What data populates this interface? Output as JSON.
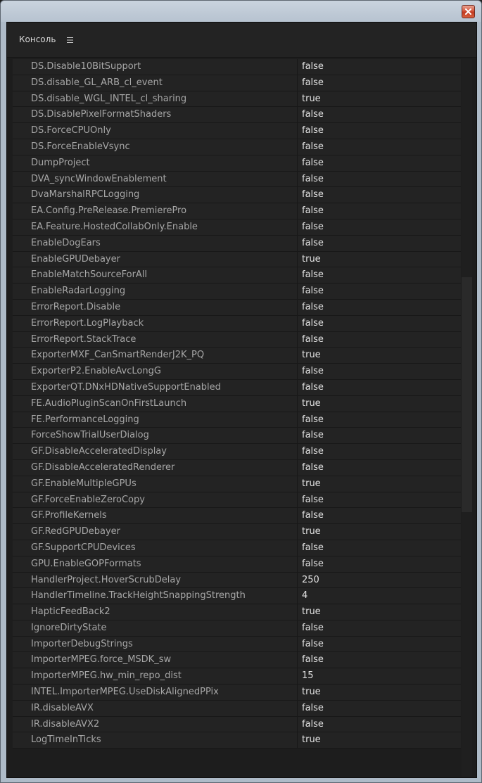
{
  "panel": {
    "title": "Консоль"
  },
  "icons": {
    "close": "close-icon",
    "panel_menu": "hamburger-menu-icon"
  },
  "colors": {
    "panel_background": "#232323",
    "name_text": "#a7a7a7",
    "value_text": "#e2e2e2",
    "close_button": "#d4563c"
  },
  "rows": [
    {
      "name": "DS.Disable10BitSupport",
      "value": "false"
    },
    {
      "name": "DS.disable_GL_ARB_cl_event",
      "value": "false"
    },
    {
      "name": "DS.disable_WGL_INTEL_cl_sharing",
      "value": "true"
    },
    {
      "name": "DS.DisablePixelFormatShaders",
      "value": "false"
    },
    {
      "name": "DS.ForceCPUOnly",
      "value": "false"
    },
    {
      "name": "DS.ForceEnableVsync",
      "value": "false"
    },
    {
      "name": "DumpProject",
      "value": "false"
    },
    {
      "name": "DVA_syncWindowEnablement",
      "value": "false"
    },
    {
      "name": "DvaMarshalRPCLogging",
      "value": "false"
    },
    {
      "name": "EA.Config.PreRelease.PremierePro",
      "value": "false"
    },
    {
      "name": "EA.Feature.HostedCollabOnly.Enable",
      "value": "false"
    },
    {
      "name": "EnableDogEars",
      "value": "false"
    },
    {
      "name": "EnableGPUDebayer",
      "value": "true"
    },
    {
      "name": "EnableMatchSourceForAll",
      "value": "false"
    },
    {
      "name": "EnableRadarLogging",
      "value": "false"
    },
    {
      "name": "ErrorReport.Disable",
      "value": "false"
    },
    {
      "name": "ErrorReport.LogPlayback",
      "value": "false"
    },
    {
      "name": "ErrorReport.StackTrace",
      "value": "false"
    },
    {
      "name": "ExporterMXF_CanSmartRenderJ2K_PQ",
      "value": "true"
    },
    {
      "name": "ExporterP2.EnableAvcLongG",
      "value": "false"
    },
    {
      "name": "ExporterQT.DNxHDNativeSupportEnabled",
      "value": "false"
    },
    {
      "name": "FE.AudioPluginScanOnFirstLaunch",
      "value": "true"
    },
    {
      "name": "FE.PerformanceLogging",
      "value": "false"
    },
    {
      "name": "ForceShowTrialUserDialog",
      "value": "false"
    },
    {
      "name": "GF.DisableAcceleratedDisplay",
      "value": "false"
    },
    {
      "name": "GF.DisableAcceleratedRenderer",
      "value": "false"
    },
    {
      "name": "GF.EnableMultipleGPUs",
      "value": "true"
    },
    {
      "name": "GF.ForceEnableZeroCopy",
      "value": "false"
    },
    {
      "name": "GF.ProfileKernels",
      "value": "false"
    },
    {
      "name": "GF.RedGPUDebayer",
      "value": "true"
    },
    {
      "name": "GF.SupportCPUDevices",
      "value": "false"
    },
    {
      "name": "GPU.EnableGOPFormats",
      "value": "false"
    },
    {
      "name": "HandlerProject.HoverScrubDelay",
      "value": "250"
    },
    {
      "name": "HandlerTimeline.TrackHeightSnappingStrength",
      "value": "4"
    },
    {
      "name": "HapticFeedBack2",
      "value": "true"
    },
    {
      "name": "IgnoreDirtyState",
      "value": "false"
    },
    {
      "name": "ImporterDebugStrings",
      "value": "false"
    },
    {
      "name": "ImporterMPEG.force_MSDK_sw",
      "value": "false"
    },
    {
      "name": "ImporterMPEG.hw_min_repo_dist",
      "value": "15"
    },
    {
      "name": "INTEL.ImporterMPEG.UseDiskAlignedPPix",
      "value": "true"
    },
    {
      "name": "IR.disableAVX",
      "value": "false"
    },
    {
      "name": "IR.disableAVX2",
      "value": "false"
    },
    {
      "name": "LogTimeInTicks",
      "value": "true"
    }
  ]
}
